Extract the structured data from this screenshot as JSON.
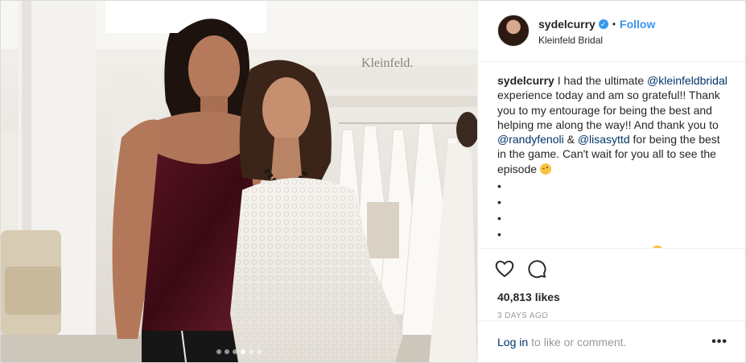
{
  "post": {
    "username": "sydelcurry",
    "follow_label": "Follow",
    "location": "Kleinfeld Bridal",
    "signage": "Kleinfeld.",
    "caption": {
      "username": "sydelcurry",
      "t1": "I had the ultimate ",
      "m1": "@kleinfeldbridal",
      "t2": " experience today and am so grateful!! Thank you to my entourage for being the best and helping me along the way!! And thank you to ",
      "m2": "@randyfenoli",
      "t3": " & ",
      "m3": "@lisasyttd",
      "t4": " for being the best in the game. Can't wait for you all to see the episode ",
      "list": [
        "•",
        "•",
        "•",
        "•"
      ]
    },
    "likes": "40,813 likes",
    "timestamp": "3 DAYS AGO",
    "comment_login": "Log in",
    "comment_rest": "to like or comment.",
    "more": "•••",
    "carousel": {
      "count": 6,
      "active_index": 3
    }
  },
  "icons": {
    "verified": "verified-badge-icon",
    "like": "heart-icon",
    "comment": "comment-bubble-icon",
    "emoji": "winking-face-emoji"
  },
  "colors": {
    "link_blue": "#3897f0",
    "mention_blue": "#003569",
    "muted": "#999999",
    "text": "#262626"
  }
}
